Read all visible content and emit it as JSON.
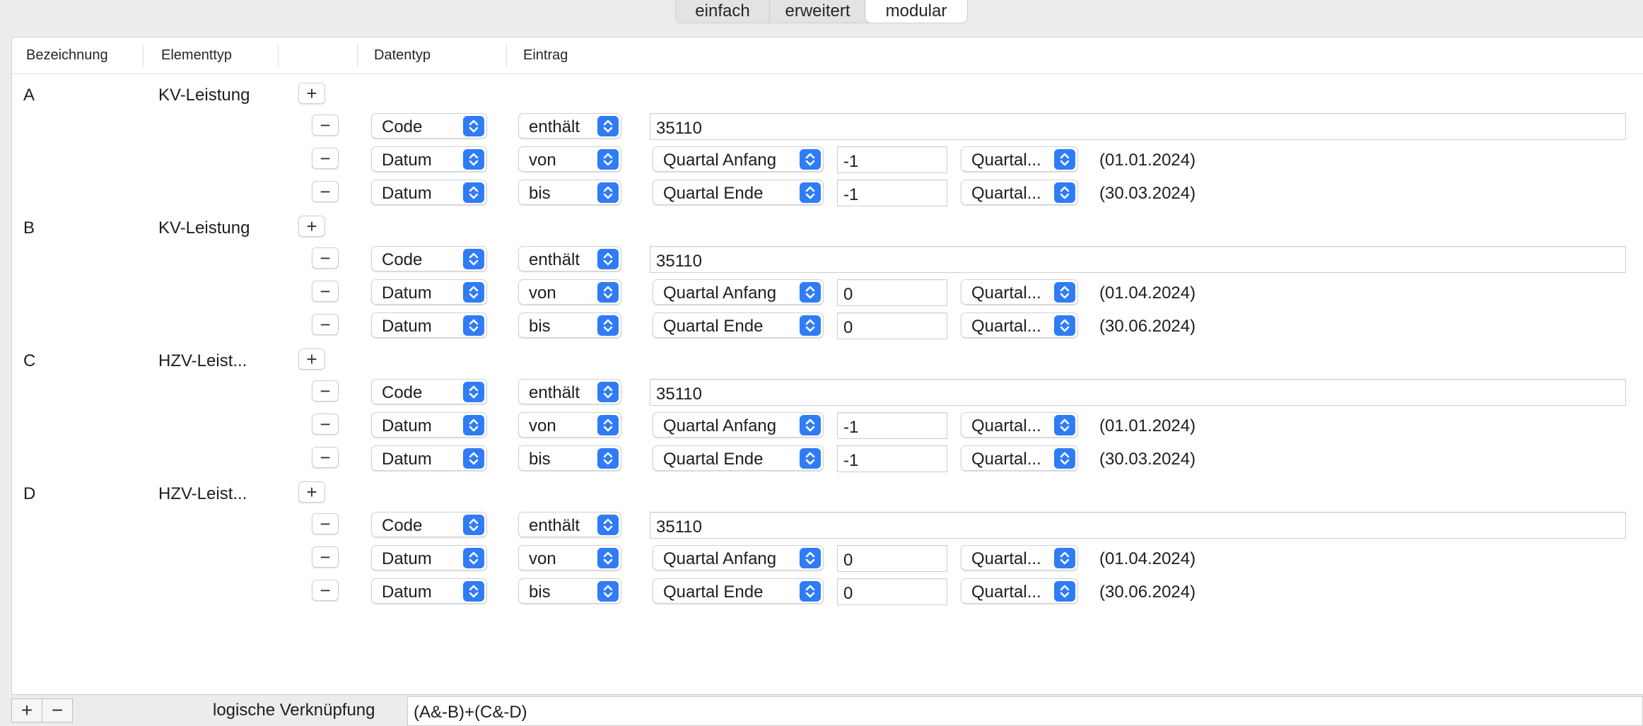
{
  "tabs": [
    {
      "label": "einfach"
    },
    {
      "label": "erweitert"
    },
    {
      "label": "modular",
      "selected": true
    }
  ],
  "columns": {
    "bezeichnung": "Bezeichnung",
    "elementtyp": "Elementtyp",
    "datentyp": "Datentyp",
    "eintrag": "Eintrag"
  },
  "icons": {
    "add": "plus-icon",
    "remove": "minus-icon",
    "popup": "chevron-updown-icon"
  },
  "colors": {
    "accent": "#2f7cf6"
  },
  "groups": [
    {
      "name": "A",
      "element_type": "KV-Leistung",
      "code": {
        "datatype": "Code",
        "operator": "enthält",
        "value": "35110"
      },
      "from": {
        "datatype": "Datum",
        "operator": "von",
        "reference": "Quartal Anfang",
        "offset": "-1",
        "unit": "Quartal...",
        "date": "(01.01.2024)"
      },
      "to": {
        "datatype": "Datum",
        "operator": "bis",
        "reference": "Quartal Ende",
        "offset": "-1",
        "unit": "Quartal...",
        "date": "(30.03.2024)"
      }
    },
    {
      "name": "B",
      "element_type": "KV-Leistung",
      "code": {
        "datatype": "Code",
        "operator": "enthält",
        "value": "35110"
      },
      "from": {
        "datatype": "Datum",
        "operator": "von",
        "reference": "Quartal Anfang",
        "offset": "0",
        "unit": "Quartal...",
        "date": "(01.04.2024)"
      },
      "to": {
        "datatype": "Datum",
        "operator": "bis",
        "reference": "Quartal Ende",
        "offset": "0",
        "unit": "Quartal...",
        "date": "(30.06.2024)"
      }
    },
    {
      "name": "C",
      "element_type": "HZV-Leist...",
      "code": {
        "datatype": "Code",
        "operator": "enthält",
        "value": "35110"
      },
      "from": {
        "datatype": "Datum",
        "operator": "von",
        "reference": "Quartal Anfang",
        "offset": "-1",
        "unit": "Quartal...",
        "date": "(01.01.2024)"
      },
      "to": {
        "datatype": "Datum",
        "operator": "bis",
        "reference": "Quartal Ende",
        "offset": "-1",
        "unit": "Quartal...",
        "date": "(30.03.2024)"
      }
    },
    {
      "name": "D",
      "element_type": "HZV-Leist...",
      "code": {
        "datatype": "Code",
        "operator": "enthält",
        "value": "35110"
      },
      "from": {
        "datatype": "Datum",
        "operator": "von",
        "reference": "Quartal Anfang",
        "offset": "0",
        "unit": "Quartal...",
        "date": "(01.04.2024)"
      },
      "to": {
        "datatype": "Datum",
        "operator": "bis",
        "reference": "Quartal Ende",
        "offset": "0",
        "unit": "Quartal...",
        "date": "(30.06.2024)"
      }
    }
  ],
  "footer": {
    "add_label": "+",
    "remove_label": "−",
    "logic_label": "logische Verknüpfung",
    "logic_value": "(A&-B)+(C&-D)"
  }
}
